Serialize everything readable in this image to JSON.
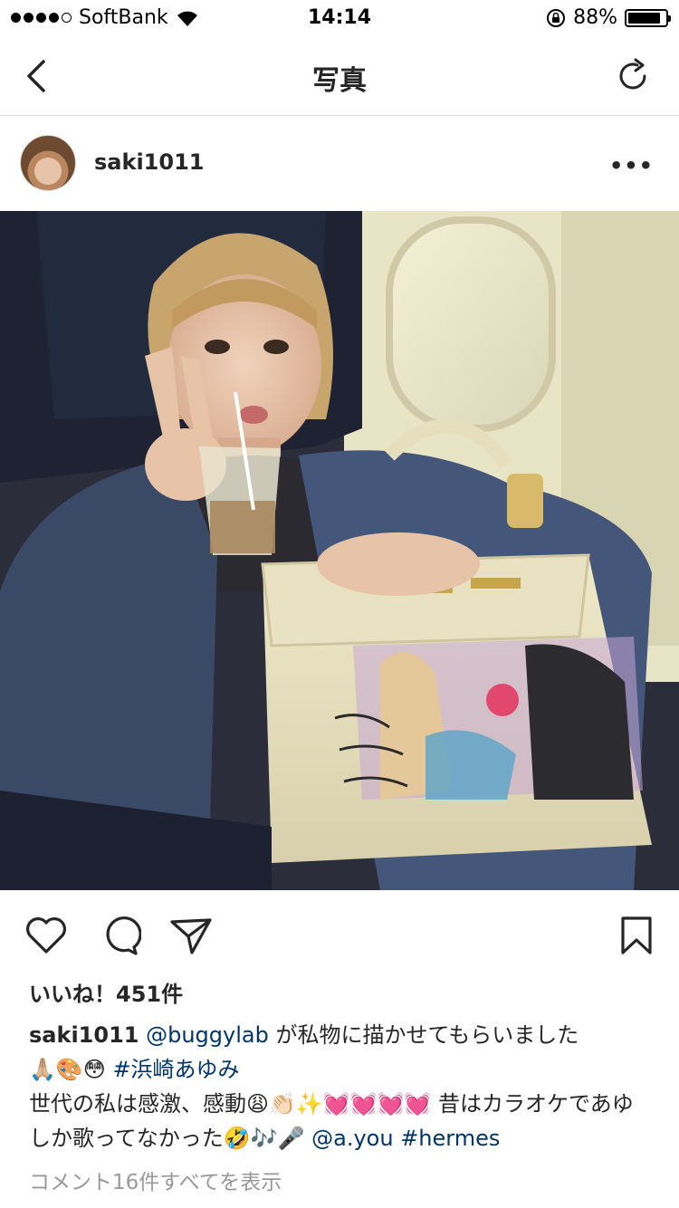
{
  "status_bar": {
    "carrier": "SoftBank",
    "time": "14:14",
    "battery": "88%",
    "battery_level": 0.88
  },
  "nav": {
    "title": "写真"
  },
  "post": {
    "username": "saki1011",
    "more": "•••",
    "likes": "いいね！451件",
    "caption": {
      "user": "saki1011",
      "mention1": "@buggylab",
      "text1": " が私物に描かせてもらいました",
      "emoji1": "🙏🏼🎨😳",
      "hashtag1": "#浜崎あゆみ",
      "text2": "世代の私は感激、感動",
      "emoji2": "😩👏🏻✨💓💓💓💓",
      "text3": " 昔はカラオケであゆしか歌ってなかった",
      "emoji3": "🤣🎶🎤",
      "mention2": "@a.you",
      "hashtag2": "#hermes"
    },
    "view_comments": "コメント16件すべてを表示"
  },
  "icons": {
    "back": "chevron-left-icon",
    "refresh": "refresh-icon",
    "like": "heart-icon",
    "comment": "comment-icon",
    "share": "send-icon",
    "save": "bookmark-icon"
  },
  "colors": {
    "link": "#003569",
    "muted": "#999999",
    "divider": "#dbdbdb"
  }
}
